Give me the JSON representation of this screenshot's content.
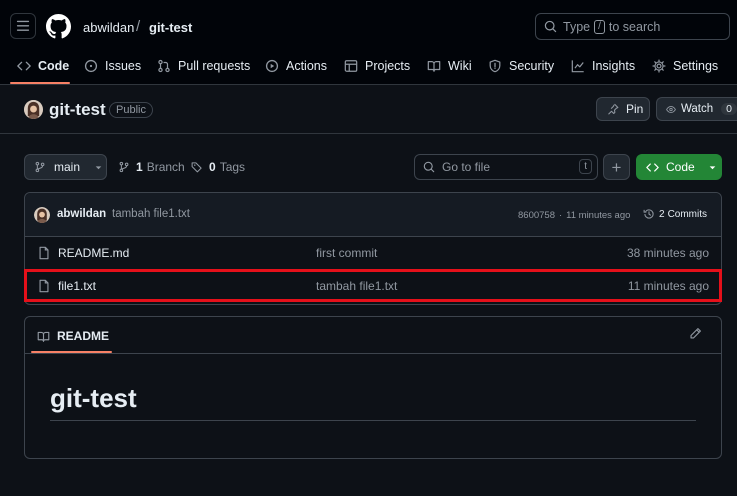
{
  "header": {
    "owner": "abwildan",
    "separator": "/",
    "repo": "git-test",
    "search": {
      "prefix": "Type",
      "key": "/",
      "suffix": "to search"
    }
  },
  "tabs": [
    {
      "label": "Code",
      "icon": "code-icon",
      "active": true
    },
    {
      "label": "Issues",
      "icon": "issue-icon"
    },
    {
      "label": "Pull requests",
      "icon": "pull-request-icon"
    },
    {
      "label": "Actions",
      "icon": "play-icon"
    },
    {
      "label": "Projects",
      "icon": "table-icon"
    },
    {
      "label": "Wiki",
      "icon": "book-icon"
    },
    {
      "label": "Security",
      "icon": "shield-icon"
    },
    {
      "label": "Insights",
      "icon": "graph-icon"
    },
    {
      "label": "Settings",
      "icon": "gear-icon"
    }
  ],
  "repo": {
    "name": "git-test",
    "visibility": "Public",
    "pin_label": "Pin",
    "watch_label": "Watch",
    "watch_count": "0"
  },
  "toolbar": {
    "branch": "main",
    "branch_count": "1",
    "branch_label": "Branch",
    "tag_count": "0",
    "tag_label": "Tags",
    "goto_placeholder": "Go to file",
    "goto_key": "t",
    "add_label": "+",
    "code_label": "Code"
  },
  "latest_commit": {
    "author": "abwildan",
    "message": "tambah file1.txt",
    "hash": "8600758",
    "sep": "·",
    "time": "11 minutes ago",
    "commits_count": "2",
    "commits_label": "Commits"
  },
  "files": [
    {
      "name": "README.md",
      "message": "first commit",
      "time": "38 minutes ago",
      "highlighted": false
    },
    {
      "name": "file1.txt",
      "message": "tambah file1.txt",
      "time": "11 minutes ago",
      "highlighted": true
    }
  ],
  "readme": {
    "tab_label": "README",
    "heading": "git-test"
  },
  "colors": {
    "accent": "#f78166",
    "code_button": "#238636",
    "highlight_border": "#e5101a"
  }
}
